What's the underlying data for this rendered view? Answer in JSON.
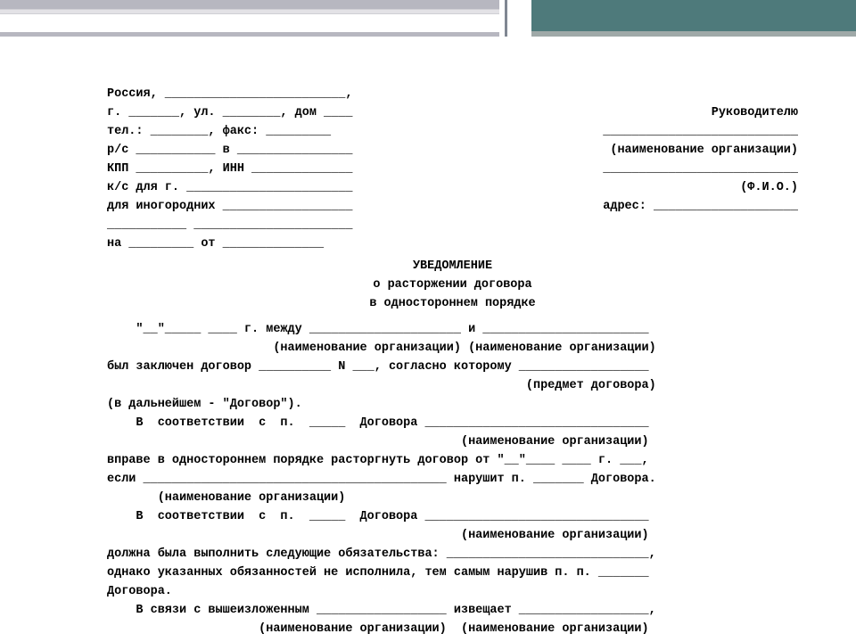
{
  "addr": {
    "l1": "Россия, _________________________,",
    "l1r": "",
    "l2": "г. _______, ул. ________, дом ____",
    "l2r": "Руководителю",
    "l3": "тел.: ________, факс: _________",
    "l3r": "___________________________",
    "l4": "р/с ___________ в ________________",
    "l4r": "(наименование организации)",
    "l5": "КПП __________, ИНН ______________",
    "l5r": "___________________________",
    "l6": "к/с для г. _______________________",
    "l6r": "(Ф.И.О.)",
    "l7": "для иногородних __________________",
    "l7r": "адрес: ____________________",
    "l8": "___________ ______________________",
    "l9": "на _________ от ______________"
  },
  "title": {
    "t1": "УВЕДОМЛЕНИЕ",
    "t2": "о расторжении договора",
    "t3": "в одностороннем порядке"
  },
  "body": {
    "b1": "    \"__\"_____ ____ г. между _____________________ и _______________________",
    "b2": "                       (наименование организации) (наименование организации)",
    "b3": "был заключен договор __________ N ___, согласно которому __________________",
    "b4": "                                                          (предмет договора)",
    "b5": "(в дальнейшем - \"Договор\").",
    "b6": "    В  соответствии  с  п.  _____  Договора _______________________________",
    "b7": "                                                 (наименование организации)",
    "b8": "вправе в одностороннем порядке расторгнуть договор от \"__\"____ ____ г. ___,",
    "b9": "если __________________________________________ нарушит п. _______ Договора.",
    "b10": "       (наименование организации)",
    "b11": "    В  соответствии  с  п.  _____  Договора _______________________________",
    "b12": "                                                 (наименование организации)",
    "b13": "должна была выполнить следующие обязательства: ____________________________,",
    "b14": "однако указанных обязанностей не исполнила, тем самым нарушив п. п. _______",
    "b15": "Договора.",
    "b16": "    В связи с вышеизложенным __________________ извещает __________________,",
    "b17": "                     (наименование организации)  (наименование организации)"
  }
}
